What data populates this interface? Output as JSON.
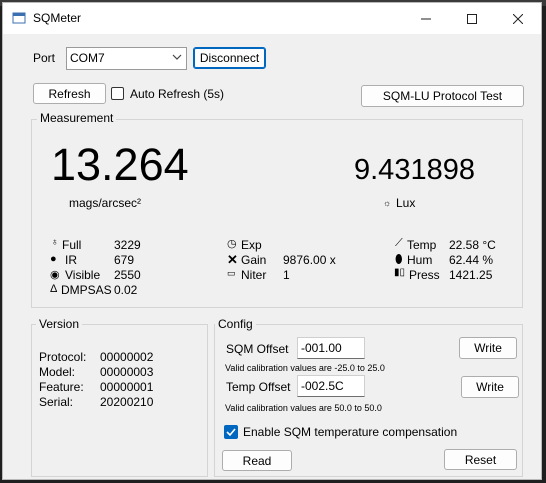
{
  "window": {
    "title": "SQMeter"
  },
  "connection": {
    "port_label": "Port",
    "port_value": "COM7",
    "disconnect_label": "Disconnect",
    "refresh_label": "Refresh",
    "auto_refresh_label": "Auto Refresh (5s)",
    "auto_refresh_checked": false,
    "protocol_test_label": "SQM-LU Protocol Test"
  },
  "measurement": {
    "group_title": "Measurement",
    "sqm_value": "13.264",
    "sqm_unit": "mags/arcsec²",
    "lux_value": "9.431898",
    "lux_unit": "Lux",
    "full_label": "Full",
    "full_value": "3229",
    "ir_label": "IR",
    "ir_value": "679",
    "visible_label": "Visible",
    "visible_value": "2550",
    "dmpsas_label": "DMPSAS",
    "dmpsas_value": "0.02",
    "exp_label": "Exp",
    "exp_value": "",
    "gain_label": "Gain",
    "gain_value": "9876.00 x",
    "niter_label": "Niter",
    "niter_value": "1",
    "temp_label": "Temp",
    "temp_value": "22.58 °C",
    "hum_label": "Hum",
    "hum_value": "62.44 %",
    "press_label": "Press",
    "press_value": "1421.25"
  },
  "version": {
    "group_title": "Version",
    "protocol_label": "Protocol:",
    "protocol_value": "00000002",
    "model_label": "Model:",
    "model_value": "00000003",
    "feature_label": "Feature:",
    "feature_value": "00000001",
    "serial_label": "Serial:",
    "serial_value": "20200210"
  },
  "config": {
    "group_title": "Config",
    "sqm_offset_label": "SQM Offset",
    "sqm_offset_value": "-001.00",
    "sqm_offset_hint": "Valid calibration values are -25.0 to 25.0",
    "temp_offset_label": "Temp Offset",
    "temp_offset_value": "-002.5C",
    "temp_offset_hint": "Valid calibration values are 50.0 to 50.0",
    "write_label": "Write",
    "compensation_label": "Enable SQM temperature compensation",
    "compensation_checked": true,
    "read_label": "Read",
    "reset_label": "Reset"
  },
  "colors": {
    "accent": "#0067c0",
    "window_bg": "#f0f0f0",
    "titlebar_bg": "#ffffff"
  }
}
